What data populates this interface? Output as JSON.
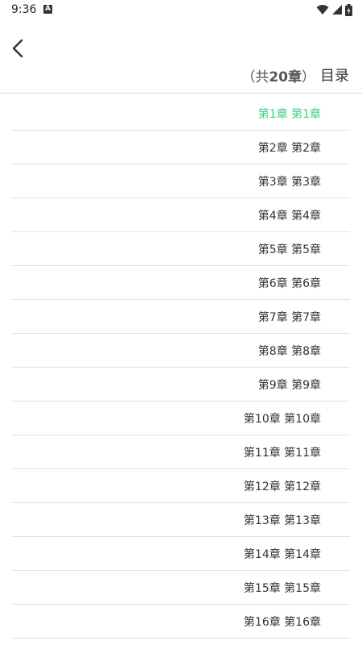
{
  "status_bar": {
    "time": "9:36",
    "icons": [
      "notification-a-icon",
      "wifi-icon",
      "signal-icon",
      "battery-icon"
    ]
  },
  "header": {
    "count_prefix": "（共",
    "count_value": "20章",
    "count_suffix": "）",
    "title": "目录"
  },
  "colors": {
    "active_chapter": "#3ccf82",
    "text": "#333333",
    "divider": "#e2e2e2"
  },
  "chapters": [
    {
      "label": "第1章 第1章",
      "active": true
    },
    {
      "label": "第2章 第2章",
      "active": false
    },
    {
      "label": "第3章 第3章",
      "active": false
    },
    {
      "label": "第4章 第4章",
      "active": false
    },
    {
      "label": "第5章 第5章",
      "active": false
    },
    {
      "label": "第6章 第6章",
      "active": false
    },
    {
      "label": "第7章 第7章",
      "active": false
    },
    {
      "label": "第8章 第8章",
      "active": false
    },
    {
      "label": "第9章 第9章",
      "active": false
    },
    {
      "label": "第10章 第10章",
      "active": false
    },
    {
      "label": "第11章 第11章",
      "active": false
    },
    {
      "label": "第12章 第12章",
      "active": false
    },
    {
      "label": "第13章 第13章",
      "active": false
    },
    {
      "label": "第14章 第14章",
      "active": false
    },
    {
      "label": "第15章 第15章",
      "active": false
    },
    {
      "label": "第16章 第16章",
      "active": false
    }
  ]
}
